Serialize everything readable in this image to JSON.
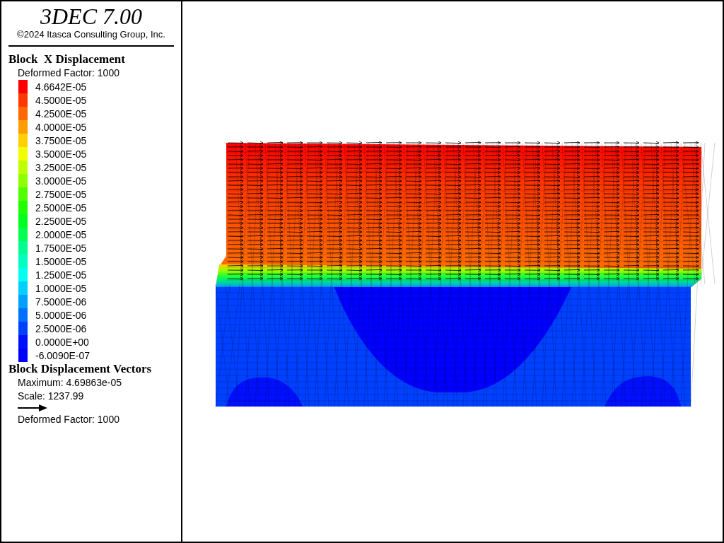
{
  "header": {
    "title": "3DEC 7.00",
    "copyright": "©2024 Itasca Consulting Group, Inc."
  },
  "contour": {
    "title": "Block  X Displacement",
    "deformed": "Deformed Factor: 1000",
    "legend": [
      {
        "label": "4.6642E-05",
        "color": "#ff0000"
      },
      {
        "label": "4.5000E-05",
        "color": "#ff3800"
      },
      {
        "label": "4.2500E-05",
        "color": "#ff6800"
      },
      {
        "label": "4.0000E-05",
        "color": "#ff9c00"
      },
      {
        "label": "3.7500E-05",
        "color": "#ffd000"
      },
      {
        "label": "3.5000E-05",
        "color": "#f0ff00"
      },
      {
        "label": "3.2500E-05",
        "color": "#c0ff00"
      },
      {
        "label": "3.0000E-05",
        "color": "#8cff00"
      },
      {
        "label": "2.7500E-05",
        "color": "#50ff00"
      },
      {
        "label": "2.5000E-05",
        "color": "#20ff00"
      },
      {
        "label": "2.2500E-05",
        "color": "#00ff20"
      },
      {
        "label": "2.0000E-05",
        "color": "#00ff50"
      },
      {
        "label": "1.7500E-05",
        "color": "#00ff90"
      },
      {
        "label": "1.5000E-05",
        "color": "#00ffc0"
      },
      {
        "label": "1.2500E-05",
        "color": "#00fff0"
      },
      {
        "label": "1.0000E-05",
        "color": "#00d0ff"
      },
      {
        "label": "7.5000E-06",
        "color": "#00a0ff"
      },
      {
        "label": "5.0000E-06",
        "color": "#0070ff"
      },
      {
        "label": "2.5000E-06",
        "color": "#0040ff"
      },
      {
        "label": "0.0000E+00",
        "color": "#0010ff"
      },
      {
        "label": "-6.0090E-07",
        "color": "#0000ff"
      }
    ]
  },
  "vectors": {
    "title": "Block Displacement Vectors",
    "maximum": "Maximum: 4.69863e-05",
    "scale": "Scale: 1237.99",
    "deformed": "Deformed Factor: 1000"
  }
}
